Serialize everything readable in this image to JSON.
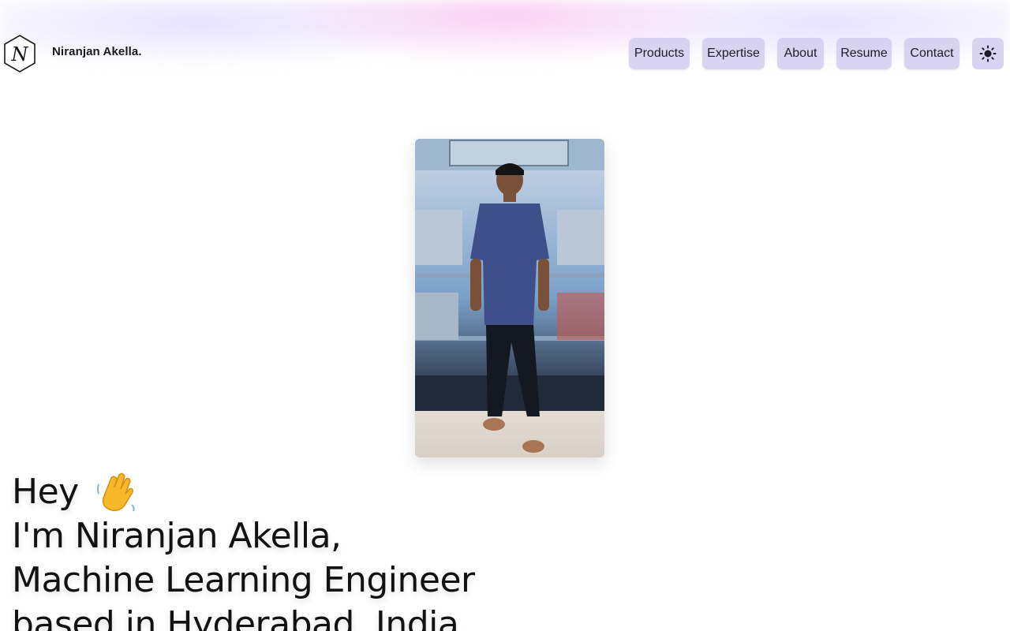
{
  "site": {
    "brand": "Niranjan Akella.",
    "logo_letter": "N"
  },
  "nav": {
    "items": [
      {
        "label": "Products"
      },
      {
        "label": "Expertise"
      },
      {
        "label": "About"
      },
      {
        "label": "Resume"
      },
      {
        "label": "Contact"
      }
    ],
    "theme_toggle_icon": "sun-icon"
  },
  "hero": {
    "greeting": "Hey",
    "greeting_icon": "waving-hand-icon",
    "line1": "I'm Niranjan Akella,",
    "line2": "Machine Learning Engineer",
    "line3": "based in Hyderabad, India."
  },
  "colors": {
    "nav_button_bg": "#d2ccee",
    "text": "#121212",
    "glow_pink": "#f4aaeb",
    "glow_lavender": "#c8beff"
  }
}
